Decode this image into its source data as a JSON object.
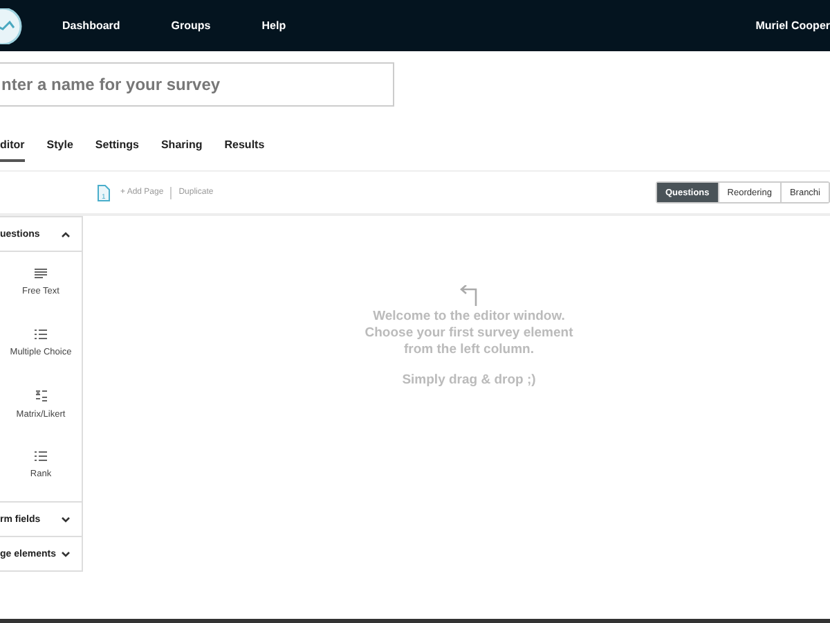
{
  "nav": {
    "links": [
      "Dashboard",
      "Groups",
      "Help"
    ],
    "user": "Muriel Cooper"
  },
  "survey_name": {
    "placeholder": "nter a name for your survey"
  },
  "tabs": [
    {
      "label": "ditor",
      "selected": true
    },
    {
      "label": "Style",
      "selected": false
    },
    {
      "label": "Settings",
      "selected": false
    },
    {
      "label": "Sharing",
      "selected": false
    },
    {
      "label": "Results",
      "selected": false
    }
  ],
  "toolbar": {
    "page_number": "1",
    "actions": [
      "+ Add Page",
      "Duplicate"
    ]
  },
  "modes": [
    {
      "label": "Questions",
      "selected": true
    },
    {
      "label": "Reordering",
      "selected": false
    },
    {
      "label": "Branchi",
      "selected": false
    }
  ],
  "sidebar": [
    {
      "title": "uestions",
      "expanded": true,
      "items": [
        {
          "label": "Free Text",
          "kind": "text"
        },
        {
          "label": "Multiple Choice",
          "kind": "list"
        },
        {
          "label": "Matrix/Likert",
          "kind": "matrix"
        },
        {
          "label": "Rank",
          "kind": "list"
        }
      ]
    },
    {
      "title": "rm fields",
      "expanded": false
    },
    {
      "title": "ge elements",
      "expanded": false
    }
  ],
  "welcome": {
    "lines": [
      "Welcome to the editor window.",
      "Choose your first survey element",
      "from the left column."
    ],
    "hint": "Simply drag & drop ;)"
  }
}
